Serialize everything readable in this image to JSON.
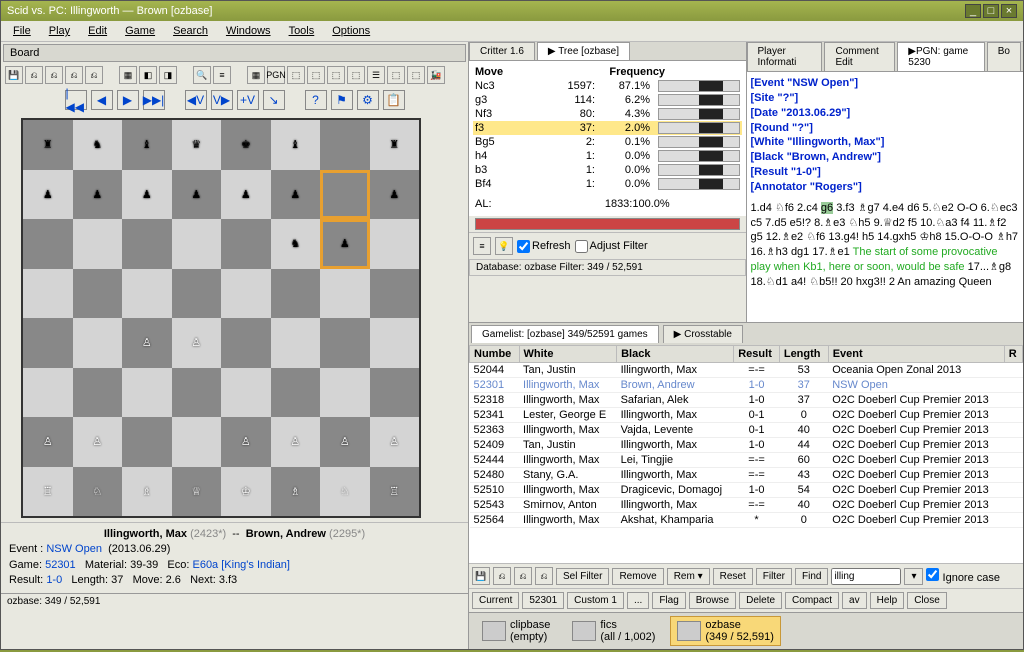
{
  "window": {
    "title": "Scid vs. PC: Illingworth — Brown [ozbase]"
  },
  "menus": [
    "File",
    "Play",
    "Edit",
    "Game",
    "Search",
    "Windows",
    "Tools",
    "Options"
  ],
  "board_tab": "Board",
  "nav_icons": [
    "|◀◀",
    "◀",
    "▶",
    "▶▶|",
    "◀V",
    "V▶",
    "+V",
    "↘",
    "?",
    "⚑",
    "⚙",
    "📋"
  ],
  "players": {
    "white": "Illingworth, Max",
    "white_elo": "(2423*)",
    "vs": "--",
    "black": "Brown, Andrew",
    "black_elo": "(2295*)"
  },
  "game_info": {
    "event_label": "Event :",
    "event": "NSW Open",
    "date": "(2013.06.29)",
    "game_label": "Game:",
    "game_no": "52301",
    "mat_label": "Material:",
    "material": "39-39",
    "eco_label": "Eco:",
    "eco": "E60a [King's Indian]",
    "result_label": "Result:",
    "result": "1-0",
    "len_label": "Length:",
    "length": "37",
    "move_label": "Move:",
    "move": "2.6",
    "next_label": "Next:",
    "next": "3.f3"
  },
  "status": "ozbase:  349 / 52,591",
  "tree": {
    "tabs": [
      "Critter 1.6",
      "▶ Tree [ozbase]"
    ],
    "header_move": "Move",
    "header_freq": "Frequency",
    "rows": [
      {
        "mv": "Nc3",
        "cnt": "1597:",
        "pct": "87.1%"
      },
      {
        "mv": "g3",
        "cnt": "114:",
        "pct": "6.2%"
      },
      {
        "mv": "Nf3",
        "cnt": "80:",
        "pct": "4.3%"
      },
      {
        "mv": "f3",
        "cnt": "37:",
        "pct": "2.0%",
        "hl": true
      },
      {
        "mv": "Bg5",
        "cnt": "2:",
        "pct": "0.1%"
      },
      {
        "mv": "h4",
        "cnt": "1:",
        "pct": "0.0%"
      },
      {
        "mv": "b3",
        "cnt": "1:",
        "pct": "0.0%"
      },
      {
        "mv": "Bf4",
        "cnt": "1:",
        "pct": "0.0%"
      }
    ],
    "total_label": "AL:",
    "total": "1833:100.0%",
    "refresh": "Refresh",
    "adjust": "Adjust Filter",
    "db_line": "Database: ozbase   Filter: 349 / 52,591"
  },
  "pgn": {
    "tabs": [
      "Player Informati",
      "Comment Edit",
      "▶PGN: game 5230",
      "Bo"
    ],
    "headers": [
      "[Event \"NSW Open\"]",
      "[Site \"?\"]",
      "[Date \"2013.06.29\"]",
      "[Round \"?\"]",
      "[White \"Illingworth, Max\"]",
      "[Black \"Brown, Andrew\"]",
      "[Result \"1-0\"]",
      "[Annotator \"Rogers\"]"
    ],
    "moves_pre": "1.d4 ♘f6 2.c4 ",
    "moves_hl": "g6",
    "moves_post": " 3.f3 ♗g7 4.e4 d6 5.♘e2 O-O 6.♘ec3 c5 7.d5 e5!? 8.♗e3 ♘h5 9.♕d2 f5 10.♘a3 f4 11.♗f2 g5 12.♗e2 ♘f6 13.g4! h5 14.gxh5 ♔h8 15.O-O-O ♗h7 16.♗h3 dg1 17.♗e1 ",
    "comment": "The start of some provocative play when Kb1, here or soon, would be safe ",
    "moves_tail": "17...♗g8 18.♘d1 a4! ♘b5!! 20 hxg3!! 2 An amazing Queen"
  },
  "gamelist": {
    "tab1": "Gamelist: [ozbase] 349/52591 games",
    "tab2": "▶ Crosstable",
    "cols": [
      "Numbe",
      "White",
      "Black",
      "Result",
      "Length",
      "Event",
      "R"
    ],
    "rows": [
      {
        "n": "52044",
        "w": "Tan, Justin",
        "b": "Illingworth, Max",
        "r": "=-=",
        "l": "53",
        "e": "Oceania Open Zonal 2013"
      },
      {
        "n": "52301",
        "w": "Illingworth, Max",
        "b": "Brown, Andrew",
        "r": "1-0",
        "l": "37",
        "e": "NSW Open",
        "sel": true
      },
      {
        "n": "52318",
        "w": "Illingworth, Max",
        "b": "Safarian, Alek",
        "r": "1-0",
        "l": "37",
        "e": "O2C Doeberl Cup Premier 2013"
      },
      {
        "n": "52341",
        "w": "Lester, George E",
        "b": "Illingworth, Max",
        "r": "0-1",
        "l": "0",
        "e": "O2C Doeberl Cup Premier 2013"
      },
      {
        "n": "52363",
        "w": "Illingworth, Max",
        "b": "Vajda, Levente",
        "r": "0-1",
        "l": "40",
        "e": "O2C Doeberl Cup Premier 2013"
      },
      {
        "n": "52409",
        "w": "Tan, Justin",
        "b": "Illingworth, Max",
        "r": "1-0",
        "l": "44",
        "e": "O2C Doeberl Cup Premier 2013"
      },
      {
        "n": "52444",
        "w": "Illingworth, Max",
        "b": "Lei, Tingjie",
        "r": "=-=",
        "l": "60",
        "e": "O2C Doeberl Cup Premier 2013"
      },
      {
        "n": "52480",
        "w": "Stany, G.A.",
        "b": "Illingworth, Max",
        "r": "=-=",
        "l": "43",
        "e": "O2C Doeberl Cup Premier 2013"
      },
      {
        "n": "52510",
        "w": "Illingworth, Max",
        "b": "Dragicevic, Domagoj",
        "r": "1-0",
        "l": "54",
        "e": "O2C Doeberl Cup Premier 2013"
      },
      {
        "n": "52543",
        "w": "Smirnov, Anton",
        "b": "Illingworth, Max",
        "r": "=-=",
        "l": "40",
        "e": "O2C Doeberl Cup Premier 2013"
      },
      {
        "n": "52564",
        "w": "Illingworth, Max",
        "b": "Akshat, Khamparia",
        "r": "*",
        "l": "0",
        "e": "O2C Doeberl Cup Premier 2013"
      }
    ],
    "buttons1": [
      "Sel Filter",
      "Remove",
      "Rem ▾",
      "Reset",
      "Filter",
      "Find"
    ],
    "find_val": "illing",
    "ignore": "Ignore case",
    "buttons2": [
      "Current",
      "52301",
      "Custom 1",
      "...",
      "Flag",
      "Browse",
      "Delete",
      "Compact",
      "av",
      "Help",
      "Close"
    ]
  },
  "db_bar": {
    "items": [
      {
        "name": "clipbase",
        "sub": "(empty)"
      },
      {
        "name": "fics",
        "sub": "(all / 1,002)"
      },
      {
        "name": "ozbase",
        "sub": "(349 / 52,591)",
        "active": true
      }
    ]
  },
  "board_pieces": {
    "a8": "♜",
    "b8": "♞",
    "c8": "♝",
    "d8": "♛",
    "e8": "♚",
    "f8": "♝",
    "h8": "♜",
    "a7": "♟",
    "b7": "♟",
    "c7": "♟",
    "d7": "♟",
    "e7": "♟",
    "f7": "♟",
    "h7": "♟",
    "f6": "♞",
    "g6": "♟",
    "c4": "♙",
    "d4": "♙",
    "a2": "♙",
    "b2": "♙",
    "e2": "♙",
    "f2": "♙",
    "g2": "♙",
    "h2": "♙",
    "a1": "♖",
    "b1": "♘",
    "c1": "♗",
    "d1": "♕",
    "e1": "♔",
    "f1": "♗",
    "g1": "♘",
    "h1": "♖"
  },
  "board_hl": [
    "g6",
    "g7"
  ]
}
